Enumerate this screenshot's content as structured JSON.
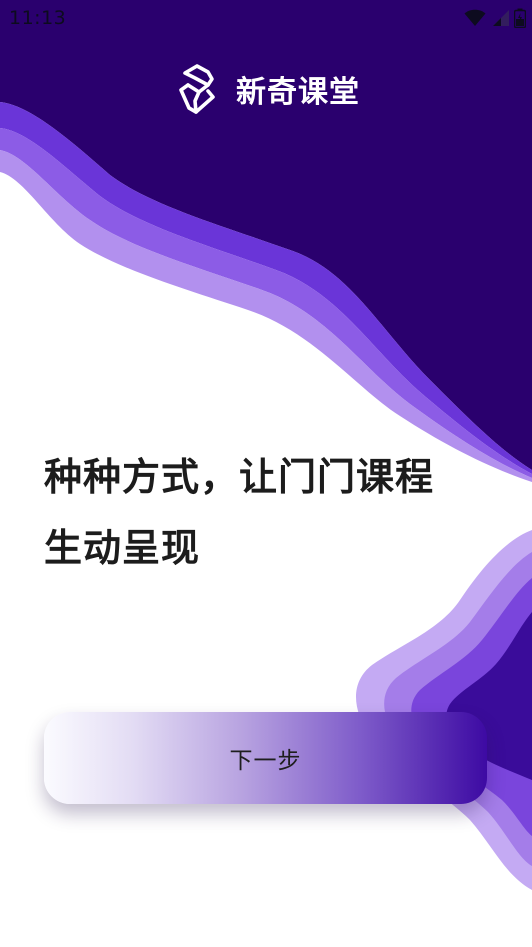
{
  "status_bar": {
    "time": "11:13",
    "icons": [
      "wifi-icon",
      "signal-icon",
      "battery-icon"
    ]
  },
  "brand": {
    "name": "新奇课堂",
    "logo_icon": "app-logo-icon"
  },
  "headline": {
    "line1": "种种方式，让门门课程",
    "line2": "生动呈现"
  },
  "next_button": {
    "label": "下一步"
  },
  "colors": {
    "brand_dark": "#2a006e",
    "wave_mid": "#6a35d8",
    "wave_light": "#a882ec",
    "wave_pale": "#c4aaf3"
  }
}
